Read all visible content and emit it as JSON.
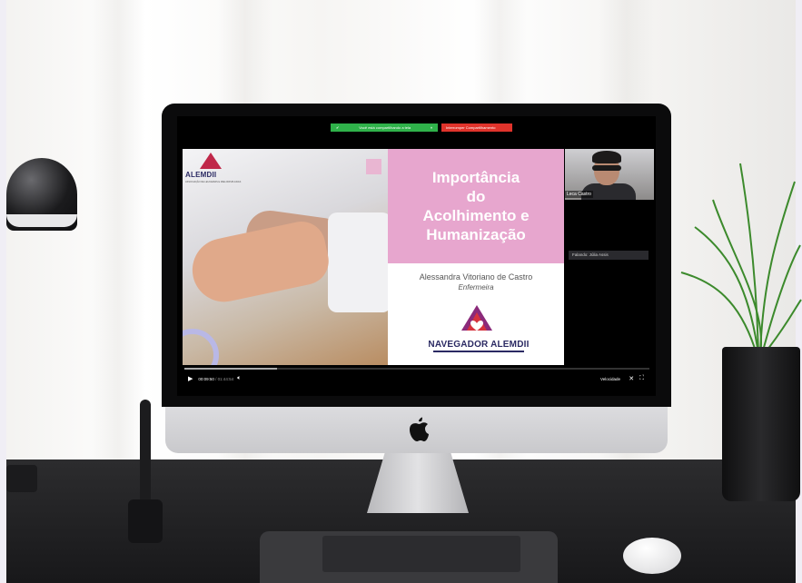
{
  "share_bar": {
    "sharing_text": "Você está compartilhando a tela",
    "stop_text": "Interromper Compartilhamento"
  },
  "slide": {
    "logo_text": "ALEMDII",
    "logo_subtext": "ASSOCIAÇÃO DE LEUCEMIAS E MIELODISPLASIAS",
    "title_lines": [
      "Importância",
      "do",
      "Acolhimento e",
      "Humanização"
    ],
    "author": "Alessandra Vitoriano de Castro",
    "role": "Enfermeira",
    "navigator_logo_text": "NAVEGADOR ALEMDII"
  },
  "participant": {
    "name": "Leca Castro",
    "speaking_label": "Falando: Júlia Assis"
  },
  "player": {
    "current_time": "00:09:50",
    "total_time": " / 01:44:54",
    "speed_label": "Velocidade",
    "progress": 0.2
  }
}
